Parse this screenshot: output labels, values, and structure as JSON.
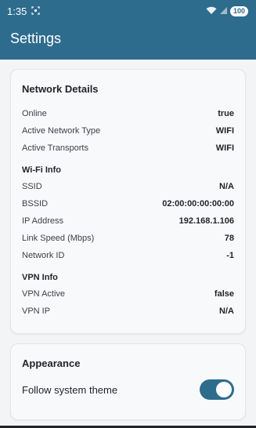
{
  "status_bar": {
    "time": "1:35",
    "battery": "100",
    "icons": [
      "screenshot-icon",
      "wifi-icon",
      "signal-icon",
      "battery-icon"
    ]
  },
  "app_bar": {
    "title": "Settings",
    "color": "#2e6c8e"
  },
  "network": {
    "title": "Network Details",
    "general": [
      {
        "label": "Online",
        "value": "true"
      },
      {
        "label": "Active Network Type",
        "value": "WIFI"
      },
      {
        "label": "Active Transports",
        "value": "WIFI"
      }
    ],
    "wifi": {
      "title": "Wi-Fi Info",
      "rows": [
        {
          "label": "SSID",
          "value": "N/A"
        },
        {
          "label": "BSSID",
          "value": "02:00:00:00:00:00"
        },
        {
          "label": "IP Address",
          "value": "192.168.1.106"
        },
        {
          "label": "Link Speed (Mbps)",
          "value": "78"
        },
        {
          "label": "Network ID",
          "value": "-1"
        }
      ]
    },
    "vpn": {
      "title": "VPN Info",
      "rows": [
        {
          "label": "VPN Active",
          "value": "false"
        },
        {
          "label": "VPN IP",
          "value": "N/A"
        }
      ]
    }
  },
  "appearance": {
    "title": "Appearance",
    "follow_system_theme_label": "Follow system theme",
    "follow_system_theme_on": true
  }
}
